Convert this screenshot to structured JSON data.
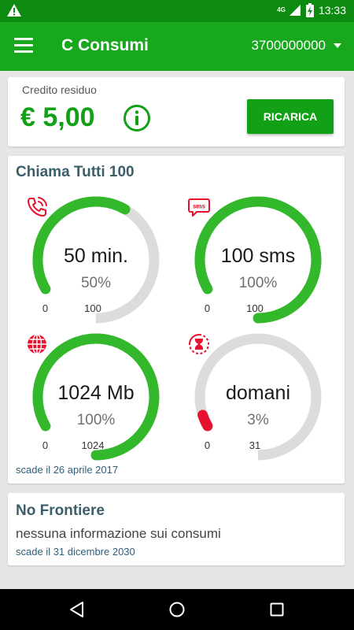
{
  "status_bar": {
    "network": "4G",
    "time": "13:33",
    "icons": [
      "warning-icon",
      "signal-icon",
      "battery-charging-icon"
    ]
  },
  "app_bar": {
    "title": "C Consumi",
    "account_number": "3700000000",
    "icons": [
      "menu-icon",
      "dropdown-caret-icon"
    ]
  },
  "credit": {
    "label": "Credito residuo",
    "value": "€ 5,00",
    "recharge_label": "RICARICA",
    "info_icon": "info-icon"
  },
  "plan": {
    "title": "Chiama Tutti 100",
    "expiry": "scade il 26 aprile 2017",
    "gauges": [
      {
        "icon": "phone-call-icon",
        "value": "50 min.",
        "percent": "50%",
        "min": "0",
        "max": "100",
        "level": 0.5,
        "color": "#33b82c"
      },
      {
        "icon": "sms-icon",
        "value": "100 sms",
        "percent": "100%",
        "min": "0",
        "max": "100",
        "level": 1.0,
        "color": "#33b82c"
      },
      {
        "icon": "globe-data-icon",
        "value": "1024 Mb",
        "percent": "100%",
        "min": "0",
        "max": "1024",
        "level": 1.0,
        "color": "#33b82c"
      },
      {
        "icon": "hourglass-icon",
        "value": "domani",
        "percent": "3%",
        "min": "0",
        "max": "31",
        "level": 0.03,
        "color": "#e8112d"
      }
    ]
  },
  "no_frontiere": {
    "title": "No Frontiere",
    "text": "nessuna informazione sui consumi",
    "expiry": "scade il 31 dicembre 2030"
  },
  "colors": {
    "primary": "#17a81d",
    "status_bar": "#0d8a10",
    "accent_red": "#e8112d",
    "track": "#dcdcdc",
    "title_text": "#3b5f6a"
  },
  "navigation": {
    "icons": [
      "back-icon",
      "home-icon",
      "recents-icon"
    ]
  }
}
